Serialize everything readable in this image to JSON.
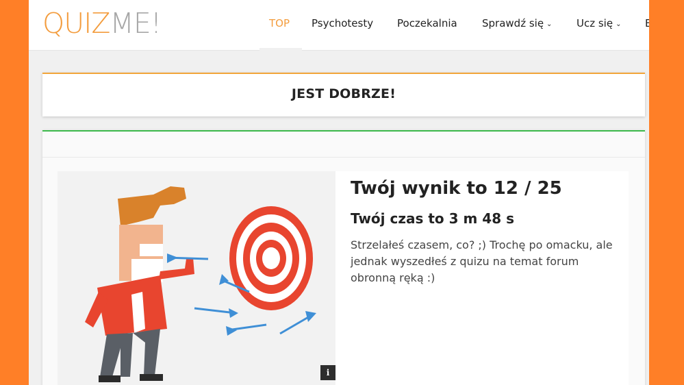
{
  "logo": {
    "part1": "QUIZ",
    "part2": "ME!"
  },
  "nav": {
    "items": [
      {
        "label": "TOP"
      },
      {
        "label": "Psychotesty"
      },
      {
        "label": "Poczekalnia"
      },
      {
        "label": "Sprawdź się"
      },
      {
        "label": "Ucz się"
      },
      {
        "label": "E"
      }
    ],
    "chevron": "⌄"
  },
  "banner": {
    "title": "JEST DOBRZE!"
  },
  "result": {
    "score": "Twój wynik to 12 / 25",
    "time": "Twój czas to 3 m 48 s",
    "description": "Strzelałeś czasem, co? ;) Trochę po omacku, ale jednak wyszedłeś z quizu na temat forum obronną ręką :)"
  },
  "info_icon": "i",
  "colors": {
    "outer_background": "#ff7f27",
    "brand_orange": "#f39c3d",
    "logo_gray": "#a7a7a7",
    "banner_accent": "#f2a53a",
    "content_accent": "#3cb94a",
    "target_red": "#e8452f",
    "dart_blue": "#3f8fd6"
  },
  "icons": {
    "info": "info-icon",
    "chevron": "chevron-down-icon",
    "illustration": "darts-target-illustration"
  }
}
